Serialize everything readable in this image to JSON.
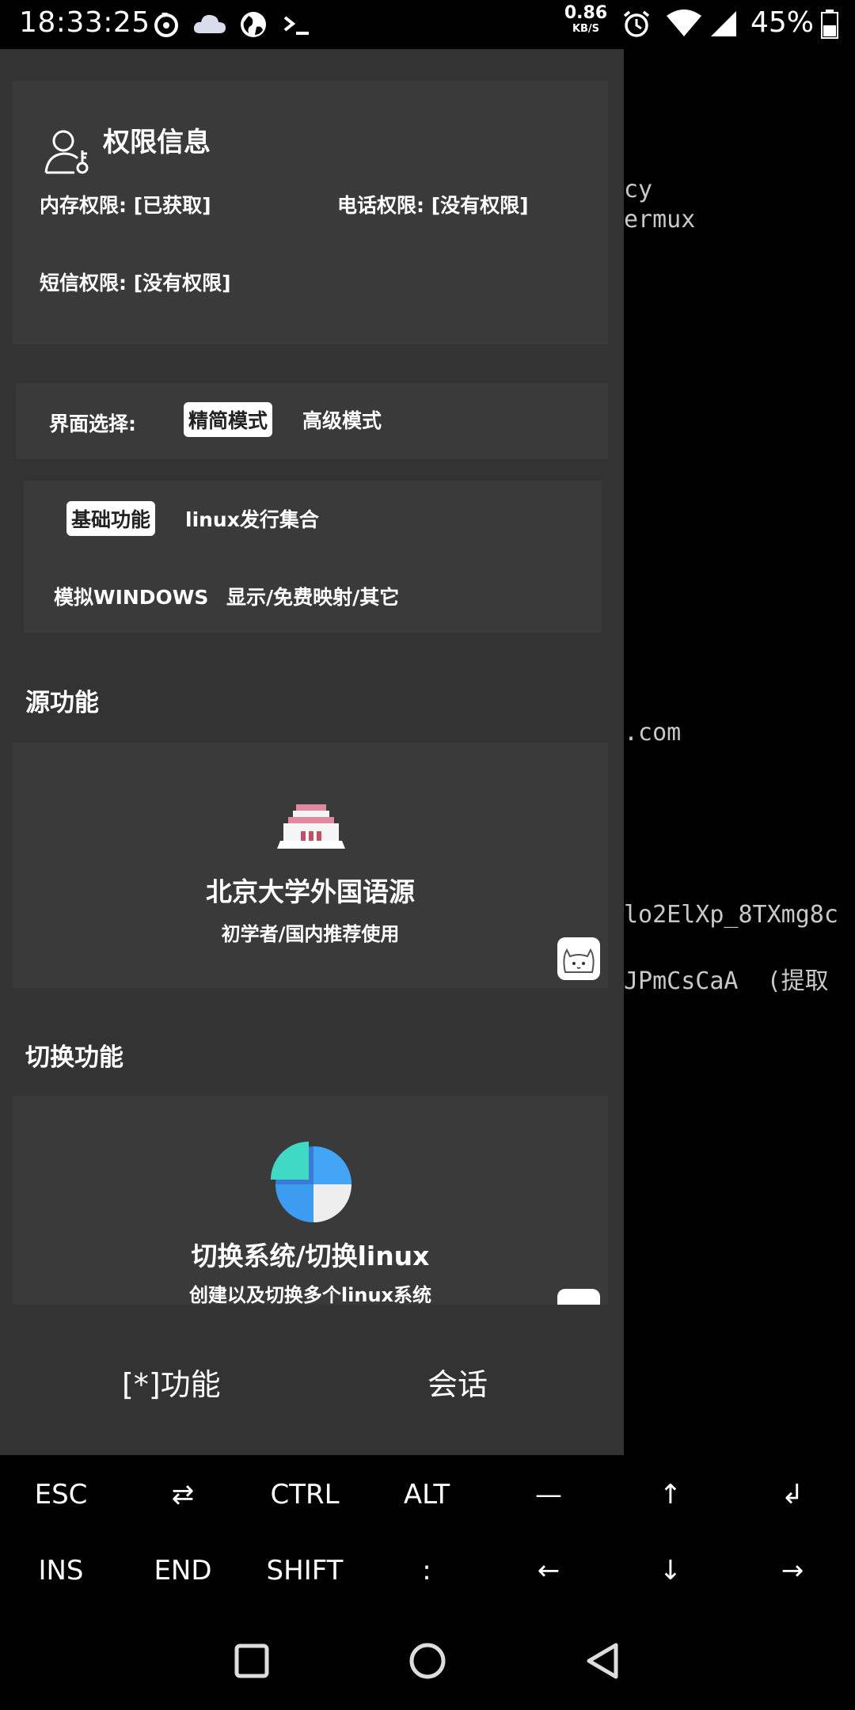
{
  "status_bar": {
    "time": "18:33:25",
    "net_speed_value": "0.86",
    "net_speed_unit": "KB/S",
    "battery": "45%",
    "icons": [
      "sync-icon",
      "cloud-icon",
      "browser-icon",
      "terminal-icon",
      "alarm-icon",
      "wifi-icon",
      "signal-icon",
      "battery-icon"
    ]
  },
  "terminal": {
    "lines": [
      "cy",
      "ermux",
      ".com",
      "lo2ElXp_8TXmg8c",
      "JPmCsCaA  (提取"
    ]
  },
  "permissions": {
    "title": "权限信息",
    "storage": "内存权限: [已获取]",
    "phone": "电话权限:  [没有权限]",
    "sms": "短信权限:  [没有权限]"
  },
  "ui_select": {
    "label": "界面选择:",
    "options": [
      "精简模式",
      "高级模式"
    ],
    "selected": "精简模式"
  },
  "func_tabs": {
    "items": [
      "基础功能",
      "linux发行集合",
      "模拟WINDOWS",
      "显示/免费映射/其它"
    ],
    "selected": "基础功能"
  },
  "sections": {
    "source": {
      "title": "源功能",
      "card_title": "北京大学外国语源",
      "card_sub": "初学者/国内推荐使用"
    },
    "switch": {
      "title": "切换功能",
      "card_title": "切换系统/切换linux",
      "card_sub": "创建以及切换多个linux系统"
    }
  },
  "bottom_tabs": {
    "functions": "[*]功能",
    "session": "会话"
  },
  "extra_keys": {
    "row1": [
      "ESC",
      "⇄",
      "CTRL",
      "ALT",
      "—",
      "↑",
      "↲"
    ],
    "row2": [
      "INS",
      "END",
      "SHIFT",
      ":",
      "←",
      "↓",
      "→"
    ]
  },
  "colors": {
    "drawer_bg": "#333333",
    "card_bg": "#3a3a3a",
    "terminal_bg": "#000000"
  }
}
